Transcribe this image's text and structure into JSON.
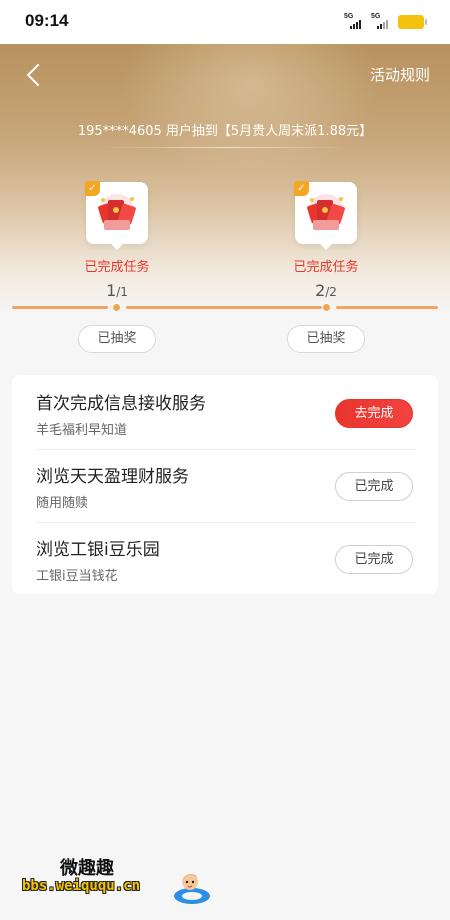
{
  "status_bar": {
    "time": "09:14",
    "signal_1": "5G",
    "signal_2": "5G",
    "battery_color": "#f4c20d"
  },
  "header": {
    "rules_label": "活动规则",
    "ticker": "195****4605 用户抽到【5月贵人周末派1.88元】"
  },
  "rewards": [
    {
      "status": "已完成任务",
      "done": "1",
      "total": "/1",
      "draw_label": "已抽奖",
      "icon": "red-envelope-gift-icon"
    },
    {
      "status": "已完成任务",
      "done": "2",
      "total": "/2",
      "draw_label": "已抽奖",
      "icon": "red-envelope-gift-icon"
    }
  ],
  "tasks": [
    {
      "title": "首次完成信息接收服务",
      "subtitle": "羊毛福利早知道",
      "action": "去完成",
      "state": "todo"
    },
    {
      "title": "浏览天天盈理财服务",
      "subtitle": "随用随赎",
      "action": "已完成",
      "state": "done"
    },
    {
      "title": "浏览工银i豆乐园",
      "subtitle": "工银i豆当钱花",
      "action": "已完成",
      "state": "done"
    }
  ],
  "watermark": {
    "title": "微趣趣",
    "url": "bbs.weiququ.cn"
  },
  "colors": {
    "accent_red": "#e8352d",
    "progress_orange": "#f2a45f",
    "check_orange": "#f5a623"
  }
}
